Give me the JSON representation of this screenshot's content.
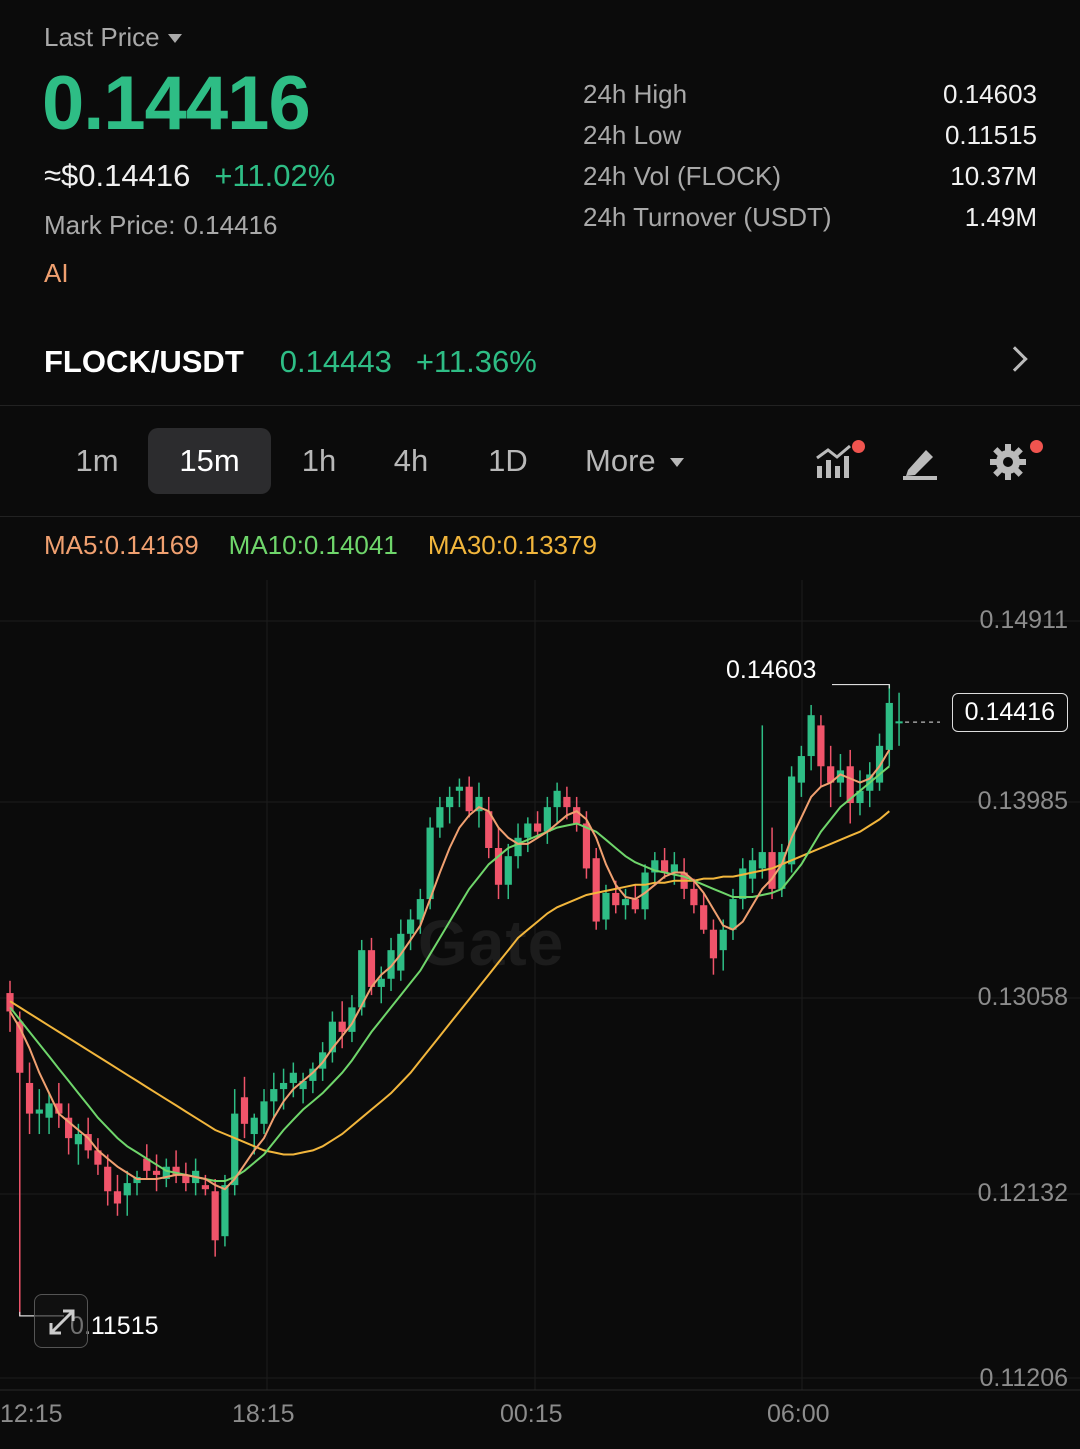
{
  "header": {
    "selector_label": "Last Price",
    "last_price": "0.14416",
    "usd_price": "≈$0.14416",
    "change_pct": "+11.02%",
    "mark_price_label": "Mark Price:",
    "mark_price_value": "0.14416",
    "ai_label": "AI"
  },
  "stats": [
    {
      "label": "24h High",
      "value": "0.14603"
    },
    {
      "label": "24h Low",
      "value": "0.11515"
    },
    {
      "label": "24h Vol (FLOCK)",
      "value": "10.37M"
    },
    {
      "label": "24h Turnover (USDT)",
      "value": "1.49M"
    }
  ],
  "pair": {
    "name": "FLOCK/USDT",
    "price": "0.14443",
    "change": "+11.36%"
  },
  "timeframes": [
    "1m",
    "15m",
    "1h",
    "4h",
    "1D"
  ],
  "active_timeframe": "15m",
  "more_label": "More",
  "tools": {
    "indicators_icon": "indicator-chart-icon",
    "draw_icon": "pencil-icon",
    "settings_icon": "gear-icon",
    "notification_color": "#f0544f"
  },
  "ma": {
    "ma5": "MA5:0.14169",
    "ma10": "MA10:0.14041",
    "ma30": "MA30:0.13379"
  },
  "colors": {
    "up": "#2ebd85",
    "down": "#f0546a",
    "ma5": "#f0a070",
    "ma10": "#6fd66b",
    "ma30": "#f2b63c"
  },
  "chart_data": {
    "type": "candlestick",
    "y_ticks": [
      "0.14911",
      "0.13985",
      "0.13058",
      "0.12132",
      "0.11206"
    ],
    "ylim": [
      0.11206,
      0.14911
    ],
    "x_ticks": [
      "12:15",
      "18:15",
      "00:15",
      "06:00"
    ],
    "high_label": "0.14603",
    "low_label": "0.11515",
    "current_price_label": "0.14416",
    "watermark": "Gate",
    "candles": [
      [
        0.1309,
        0.1315,
        0.129,
        0.13
      ],
      [
        0.1295,
        0.13,
        0.1151,
        0.127
      ],
      [
        0.1265,
        0.1275,
        0.124,
        0.125
      ],
      [
        0.125,
        0.1262,
        0.124,
        0.1252
      ],
      [
        0.1248,
        0.126,
        0.124,
        0.1255
      ],
      [
        0.1255,
        0.1265,
        0.1243,
        0.125
      ],
      [
        0.1248,
        0.1255,
        0.123,
        0.1238
      ],
      [
        0.1235,
        0.1245,
        0.1225,
        0.124
      ],
      [
        0.124,
        0.1248,
        0.1228,
        0.1232
      ],
      [
        0.1232,
        0.1238,
        0.122,
        0.1225
      ],
      [
        0.1224,
        0.123,
        0.1205,
        0.1212
      ],
      [
        0.1212,
        0.122,
        0.12,
        0.1206
      ],
      [
        0.121,
        0.1222,
        0.12,
        0.1216
      ],
      [
        0.1216,
        0.1222,
        0.121,
        0.1219
      ],
      [
        0.1228,
        0.1235,
        0.1218,
        0.1222
      ],
      [
        0.1222,
        0.123,
        0.1212,
        0.122
      ],
      [
        0.1218,
        0.1228,
        0.1214,
        0.1224
      ],
      [
        0.1224,
        0.1232,
        0.1216,
        0.122
      ],
      [
        0.122,
        0.1226,
        0.1212,
        0.1216
      ],
      [
        0.1216,
        0.1228,
        0.121,
        0.1222
      ],
      [
        0.1215,
        0.122,
        0.121,
        0.1213
      ],
      [
        0.1212,
        0.1218,
        0.118,
        0.1188
      ],
      [
        0.119,
        0.122,
        0.1185,
        0.1215
      ],
      [
        0.1215,
        0.1262,
        0.121,
        0.125
      ],
      [
        0.1258,
        0.1268,
        0.1238,
        0.1245
      ],
      [
        0.124,
        0.125,
        0.123,
        0.1248
      ],
      [
        0.1245,
        0.1262,
        0.124,
        0.1256
      ],
      [
        0.1256,
        0.127,
        0.1248,
        0.1262
      ],
      [
        0.1262,
        0.1272,
        0.1252,
        0.1265
      ],
      [
        0.1265,
        0.1275,
        0.1258,
        0.127
      ],
      [
        0.1262,
        0.127,
        0.1255,
        0.1266
      ],
      [
        0.1266,
        0.1275,
        0.126,
        0.1272
      ],
      [
        0.1272,
        0.1285,
        0.1266,
        0.128
      ],
      [
        0.128,
        0.13,
        0.1275,
        0.1295
      ],
      [
        0.1295,
        0.1305,
        0.1282,
        0.129
      ],
      [
        0.129,
        0.1308,
        0.1285,
        0.1302
      ],
      [
        0.1302,
        0.1335,
        0.1298,
        0.133
      ],
      [
        0.133,
        0.1336,
        0.1308,
        0.1312
      ],
      [
        0.1312,
        0.1322,
        0.1304,
        0.1316
      ],
      [
        0.1316,
        0.1336,
        0.131,
        0.133
      ],
      [
        0.132,
        0.1345,
        0.1315,
        0.1338
      ],
      [
        0.1338,
        0.135,
        0.133,
        0.1345
      ],
      [
        0.1345,
        0.136,
        0.1338,
        0.1355
      ],
      [
        0.1355,
        0.1395,
        0.135,
        0.139
      ],
      [
        0.139,
        0.1405,
        0.1385,
        0.14
      ],
      [
        0.14,
        0.141,
        0.1392,
        0.1405
      ],
      [
        0.1408,
        0.1414,
        0.14,
        0.141
      ],
      [
        0.141,
        0.1415,
        0.1395,
        0.1398
      ],
      [
        0.1398,
        0.1412,
        0.139,
        0.1405
      ],
      [
        0.1398,
        0.1405,
        0.1375,
        0.138
      ],
      [
        0.138,
        0.139,
        0.1355,
        0.1362
      ],
      [
        0.1362,
        0.1382,
        0.1355,
        0.1376
      ],
      [
        0.1376,
        0.1392,
        0.137,
        0.1385
      ],
      [
        0.1385,
        0.1395,
        0.1378,
        0.1392
      ],
      [
        0.1392,
        0.1398,
        0.1385,
        0.1388
      ],
      [
        0.1388,
        0.1405,
        0.1382,
        0.14
      ],
      [
        0.14,
        0.1412,
        0.1392,
        0.1408
      ],
      [
        0.1405,
        0.141,
        0.1394,
        0.14
      ],
      [
        0.14,
        0.1405,
        0.1388,
        0.1392
      ],
      [
        0.1392,
        0.1398,
        0.1365,
        0.137
      ],
      [
        0.1375,
        0.138,
        0.134,
        0.1344
      ],
      [
        0.1345,
        0.1362,
        0.134,
        0.1358
      ],
      [
        0.1358,
        0.1364,
        0.1348,
        0.1352
      ],
      [
        0.1352,
        0.136,
        0.1345,
        0.1355
      ],
      [
        0.1355,
        0.1362,
        0.1348,
        0.135
      ],
      [
        0.135,
        0.1372,
        0.1345,
        0.1368
      ],
      [
        0.1368,
        0.1378,
        0.1362,
        0.1374
      ],
      [
        0.1374,
        0.138,
        0.1365,
        0.1368
      ],
      [
        0.1368,
        0.1378,
        0.1362,
        0.1372
      ],
      [
        0.1368,
        0.1375,
        0.1355,
        0.136
      ],
      [
        0.136,
        0.1365,
        0.1348,
        0.1352
      ],
      [
        0.1352,
        0.1358,
        0.1338,
        0.134
      ],
      [
        0.134,
        0.1345,
        0.1318,
        0.1326
      ],
      [
        0.133,
        0.1345,
        0.132,
        0.134
      ],
      [
        0.134,
        0.136,
        0.1335,
        0.1355
      ],
      [
        0.1355,
        0.1375,
        0.135,
        0.137
      ],
      [
        0.1365,
        0.138,
        0.1358,
        0.1374
      ],
      [
        0.137,
        0.144,
        0.1365,
        0.1378
      ],
      [
        0.1378,
        0.139,
        0.1355,
        0.136
      ],
      [
        0.136,
        0.1382,
        0.1356,
        0.1378
      ],
      [
        0.1372,
        0.142,
        0.1368,
        0.1415
      ],
      [
        0.1412,
        0.143,
        0.1405,
        0.1425
      ],
      [
        0.1425,
        0.145,
        0.1418,
        0.1445
      ],
      [
        0.144,
        0.1445,
        0.141,
        0.142
      ],
      [
        0.142,
        0.143,
        0.14,
        0.1412
      ],
      [
        0.1412,
        0.1426,
        0.1405,
        0.1418
      ],
      [
        0.142,
        0.1428,
        0.1392,
        0.1402
      ],
      [
        0.1402,
        0.1418,
        0.1396,
        0.1408
      ],
      [
        0.1408,
        0.1422,
        0.14,
        0.1416
      ],
      [
        0.1412,
        0.1436,
        0.1408,
        0.143
      ],
      [
        0.1428,
        0.146,
        0.142,
        0.1451
      ],
      [
        0.1441,
        0.1456,
        0.143,
        0.1442
      ]
    ],
    "ma5": [
      0.13,
      0.1292,
      0.1282,
      0.127,
      0.126,
      0.125,
      0.1246,
      0.1242,
      0.1238,
      0.1232,
      0.1228,
      0.1224,
      0.1221,
      0.1218,
      0.1218,
      0.1218,
      0.1219,
      0.122,
      0.122,
      0.1219,
      0.1218,
      0.1215,
      0.1213,
      0.1218,
      0.1225,
      0.1232,
      0.1238,
      0.1248,
      0.1256,
      0.1262,
      0.1266,
      0.127,
      0.1275,
      0.1282,
      0.1288,
      0.1294,
      0.1303,
      0.1312,
      0.1318,
      0.1322,
      0.1328,
      0.1335,
      0.1342,
      0.1355,
      0.1368,
      0.138,
      0.139,
      0.1396,
      0.14,
      0.1398,
      0.139,
      0.1385,
      0.1382,
      0.1382,
      0.1385,
      0.1388,
      0.1392,
      0.1396,
      0.1398,
      0.1394,
      0.1385,
      0.1372,
      0.1362,
      0.1356,
      0.1355,
      0.1358,
      0.1362,
      0.1366,
      0.1368,
      0.1368,
      0.1364,
      0.1358,
      0.135,
      0.1342,
      0.134,
      0.1344,
      0.1352,
      0.136,
      0.1365,
      0.1372,
      0.1385,
      0.1395,
      0.1405,
      0.141,
      0.1412,
      0.1416,
      0.1414,
      0.1412,
      0.1414,
      0.142,
      0.1428
    ],
    "ma10": [
      0.1302,
      0.1296,
      0.129,
      0.1284,
      0.1278,
      0.1272,
      0.1266,
      0.126,
      0.1254,
      0.1248,
      0.1243,
      0.1238,
      0.1234,
      0.1231,
      0.1228,
      0.1225,
      0.1222,
      0.1221,
      0.122,
      0.1219,
      0.1218,
      0.1217,
      0.1217,
      0.1219,
      0.1222,
      0.1226,
      0.123,
      0.1236,
      0.1242,
      0.1247,
      0.1252,
      0.1256,
      0.126,
      0.1265,
      0.127,
      0.1276,
      0.1283,
      0.129,
      0.1296,
      0.1302,
      0.1308,
      0.1314,
      0.132,
      0.1328,
      0.1336,
      0.1344,
      0.1352,
      0.136,
      0.1366,
      0.1372,
      0.1376,
      0.138,
      0.1382,
      0.1384,
      0.1386,
      0.1388,
      0.139,
      0.1391,
      0.1392,
      0.139,
      0.1388,
      0.1384,
      0.138,
      0.1376,
      0.1373,
      0.1371,
      0.1369,
      0.1368,
      0.1367,
      0.1366,
      0.1364,
      0.1362,
      0.136,
      0.1358,
      0.1356,
      0.1356,
      0.1356,
      0.1357,
      0.1358,
      0.136,
      0.1366,
      0.1372,
      0.138,
      0.1388,
      0.1394,
      0.14,
      0.1404,
      0.1408,
      0.1412,
      0.1416,
      0.142
    ],
    "ma30": [
      0.1305,
      0.1302,
      0.1299,
      0.1296,
      0.1293,
      0.129,
      0.1287,
      0.1284,
      0.1281,
      0.1278,
      0.1275,
      0.1272,
      0.1269,
      0.1266,
      0.1263,
      0.126,
      0.1257,
      0.1254,
      0.1251,
      0.1248,
      0.1245,
      0.1242,
      0.124,
      0.1238,
      0.1236,
      0.1234,
      0.1232,
      0.1231,
      0.123,
      0.123,
      0.1231,
      0.1232,
      0.1234,
      0.1237,
      0.124,
      0.1244,
      0.1248,
      0.1252,
      0.1256,
      0.126,
      0.1265,
      0.127,
      0.1276,
      0.1282,
      0.1288,
      0.1294,
      0.13,
      0.1306,
      0.1312,
      0.1318,
      0.1324,
      0.133,
      0.1336,
      0.134,
      0.1344,
      0.1348,
      0.1351,
      0.1353,
      0.1355,
      0.1357,
      0.1358,
      0.1359,
      0.136,
      0.1361,
      0.1362,
      0.1362,
      0.1363,
      0.1363,
      0.1364,
      0.1364,
      0.1364,
      0.1365,
      0.1365,
      0.1366,
      0.1366,
      0.1367,
      0.1368,
      0.1369,
      0.137,
      0.1372,
      0.1374,
      0.1376,
      0.1378,
      0.138,
      0.1382,
      0.1384,
      0.1386,
      0.1388,
      0.1391,
      0.1394,
      0.1398
    ]
  }
}
